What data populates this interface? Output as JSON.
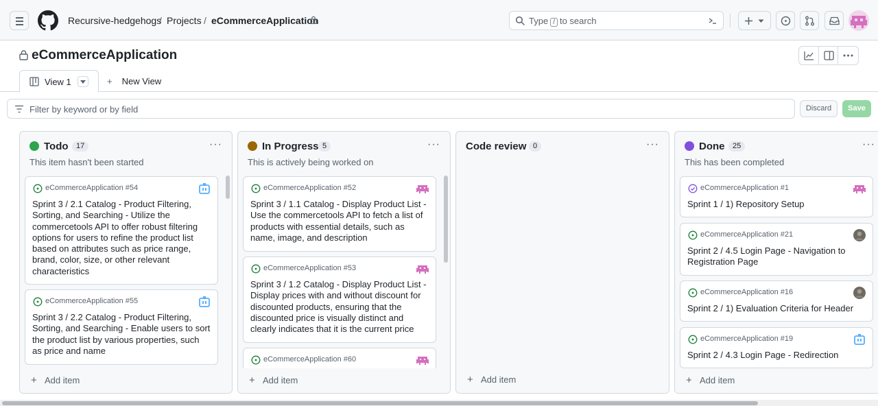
{
  "header": {
    "breadcrumb": [
      "Recursive-hedgehogs",
      "Projects",
      "eCommerceApplication"
    ],
    "separator": "/",
    "search_pre": "Type",
    "search_key": "/",
    "search_post": "to search"
  },
  "project": {
    "title": "eCommerceApplication"
  },
  "views": {
    "active_label": "View 1",
    "new_label": "New View"
  },
  "filter": {
    "placeholder": "Filter by keyword or by field",
    "discard_label": "Discard",
    "save_label": "Save"
  },
  "columns": [
    {
      "name": "Todo",
      "count": "17",
      "color": "#2da44e",
      "description": "This item hasn't been started",
      "add_label": "Add item",
      "cards": [
        {
          "ref": "eCommerceApplication #54",
          "title": "Sprint 3 / 2.1 Catalog - Product Filtering, Sorting, and Searching - Utilize the commercetools API to offer robust filtering options for users to refine the product list based on attributes such as price range, brand, color, size, or other relevant characteristics",
          "status": "open",
          "avatar": "blue-robot"
        },
        {
          "ref": "eCommerceApplication #55",
          "title": "Sprint 3 / 2.2 Catalog - Product Filtering, Sorting, and Searching - Enable users to sort the product list by various properties, such as price and name",
          "status": "open",
          "avatar": "blue-robot"
        }
      ]
    },
    {
      "name": "In Progress",
      "count": "5",
      "color": "#9a6700",
      "description": "This is actively being worked on",
      "add_label": "Add item",
      "cards": [
        {
          "ref": "eCommerceApplication #52",
          "title": "Sprint 3 / 1.1 Catalog - Display Product List - Use the commercetools API to fetch a list of products with essential details, such as name, image, and description",
          "status": "open",
          "avatar": "pink-invader"
        },
        {
          "ref": "eCommerceApplication #53",
          "title": "Sprint 3 / 1.2 Catalog - Display Product List - Display prices with and without discount for discounted products, ensuring that the discounted price is visually distinct and clearly indicates that it is the current price",
          "status": "open",
          "avatar": "pink-invader"
        },
        {
          "ref": "eCommerceApplication #60",
          "title": "",
          "status": "open",
          "avatar": "pink-invader"
        }
      ]
    },
    {
      "name": "Code review",
      "count": "0",
      "color": "",
      "description": "",
      "add_label": "Add item",
      "cards": []
    },
    {
      "name": "Done",
      "count": "25",
      "color": "#8250df",
      "description": "This has been completed",
      "add_label": "Add item",
      "cards": [
        {
          "ref": "eCommerceApplication #1",
          "title": "Sprint 1 / 1) Repository Setup",
          "status": "done",
          "avatar": "pink-invader"
        },
        {
          "ref": "eCommerceApplication #21",
          "title": "Sprint 2 / 4.5 Login Page - Navigation to Registration Page",
          "status": "open",
          "avatar": "photo"
        },
        {
          "ref": "eCommerceApplication #16",
          "title": "Sprint 2 / 1) Evaluation Criteria for Header",
          "status": "open",
          "avatar": "photo"
        },
        {
          "ref": "eCommerceApplication #19",
          "title": "Sprint 2 / 4.3 Login Page - Redirection",
          "status": "open",
          "avatar": "blue-robot"
        }
      ]
    }
  ]
}
